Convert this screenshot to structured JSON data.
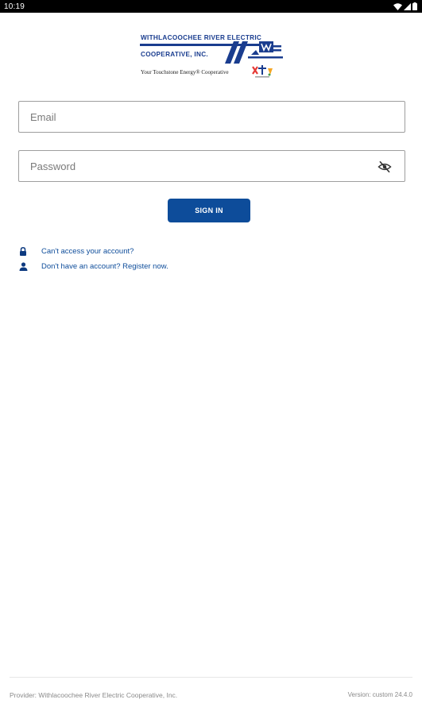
{
  "status_bar": {
    "time": "10:19"
  },
  "logo": {
    "line1": "WITHLACOOCHEE RIVER ELECTRIC",
    "line2": "COOPERATIVE, INC.",
    "tagline": "Your Touchstone Energy® Cooperative",
    "brand_color": "#1a3d8f"
  },
  "login_form": {
    "email_placeholder": "Email",
    "password_placeholder": "Password",
    "signin_label": "SIGN IN",
    "accent_color": "#0d4c9a"
  },
  "help_links": {
    "cant_access": "Can't access your account?",
    "register": "Don't have an account? Register now."
  },
  "footer": {
    "provider": "Provider: Withlacoochee River Electric Cooperative, Inc.",
    "version": "Version: custom 24.4.0"
  },
  "icons": {
    "eye_toggle": "eye-off-icon",
    "lock": "lock-icon",
    "person": "person-icon"
  }
}
